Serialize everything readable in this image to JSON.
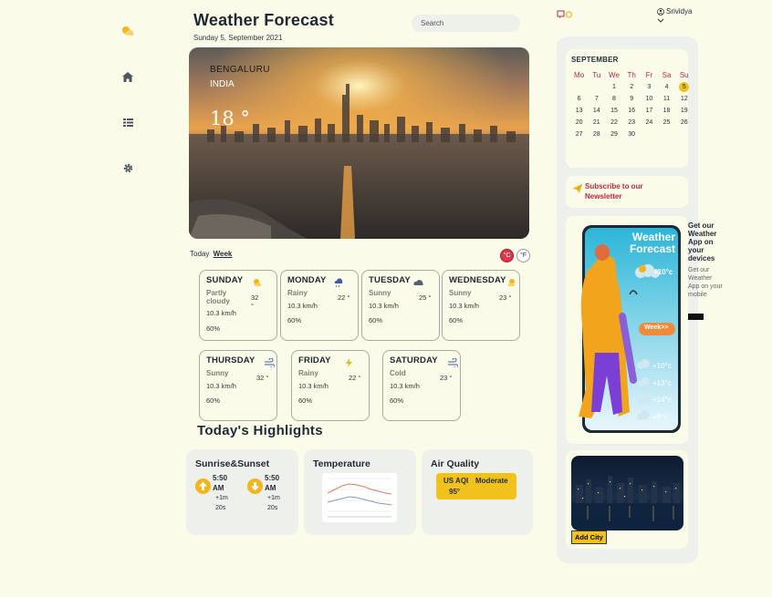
{
  "sidebar": {
    "icons": [
      "weather-icon",
      "home-icon",
      "list-icon",
      "gear-icon"
    ]
  },
  "header": {
    "title": "Weather Forecast",
    "date": "Sunday 5, September 2021",
    "search_placeholder": "Search"
  },
  "location": {
    "city": "BENGALURU",
    "country": "INDIA",
    "temp": "18 °"
  },
  "tabs": {
    "today": "Today",
    "week": "Week"
  },
  "units": {
    "celsius": "°C",
    "fahrenheit": "°F"
  },
  "days": [
    {
      "name": "SUNDAY",
      "condition": "Partly cloudy",
      "temp": "32 °",
      "wind": "10.3 km/h",
      "humidity": "60%",
      "icon": "partly-cloudy-icon"
    },
    {
      "name": "MONDAY",
      "condition": "Rainy",
      "temp": "22 °",
      "wind": "10.3 km/h",
      "humidity": "60%",
      "icon": "rain-icon"
    },
    {
      "name": "TUESDAY",
      "condition": "Sunny",
      "temp": "25 °",
      "wind": "10.3 km/h",
      "humidity": "60%",
      "icon": "cloud-icon"
    },
    {
      "name": "WEDNESDAY",
      "condition": "Sunny",
      "temp": "23 °",
      "wind": "10.3 km/h",
      "humidity": "60%",
      "icon": "sun-cloud-icon"
    },
    {
      "name": "THURSDAY",
      "condition": "Sunny",
      "temp": "32 °",
      "wind": "10.3 km/h",
      "humidity": "60%",
      "icon": "wind-icon"
    },
    {
      "name": "FRIDAY",
      "condition": "Rainy",
      "temp": "22 °",
      "wind": "10.3 km/h",
      "humidity": "60%",
      "icon": "lightning-icon"
    },
    {
      "name": "SATURDAY",
      "condition": "Cold",
      "temp": "23 °",
      "wind": "10.3 km/h",
      "humidity": "60%",
      "icon": "wind-icon"
    }
  ],
  "highlights": {
    "title": "Today's Highlights",
    "sun": {
      "label": "Sunrise&Sunset",
      "sunrise_time": "5:50",
      "sunrise_ampm": "AM",
      "sunrise_delta": "+1m",
      "sunrise_sec": "20s",
      "sunset_time": "5:50",
      "sunset_ampm": "AM",
      "sunset_delta": "+1m",
      "sunset_sec": "20s"
    },
    "temperature": {
      "label": "Temperature"
    },
    "air": {
      "label": "Air Quality",
      "index_label": "US AQI",
      "status": "Moderate",
      "value": "95°"
    }
  },
  "user": {
    "name": "Srividya"
  },
  "calendar": {
    "month": "SEPTEMBER",
    "weekdays": [
      "Mo",
      "Tu",
      "We",
      "Th",
      "Fr",
      "Sa",
      "Su"
    ],
    "days": [
      "",
      "",
      "1",
      "2",
      "3",
      "4",
      "5",
      "6",
      "7",
      "8",
      "9",
      "10",
      "11",
      "12",
      "13",
      "14",
      "15",
      "16",
      "17",
      "18",
      "19",
      "20",
      "21",
      "22",
      "23",
      "24",
      "25",
      "26",
      "27",
      "28",
      "29",
      "30"
    ],
    "selected": "5"
  },
  "subscribe": {
    "text": "Subscribe to our Newsletter"
  },
  "promo": {
    "title": "Get our Weather App on your devices",
    "subtitle": "Get our Weather App on your mobile",
    "phone_title": "Weather Forecast",
    "main_temp": "+10°c",
    "week_btn": "Week>>",
    "temps": [
      "+10°c",
      "+13°c",
      "+14°c",
      "+9°c"
    ]
  },
  "city": {
    "add_label": "Add City"
  },
  "colors": {
    "background": "#fbfbea",
    "accent": "#f2c21c",
    "danger": "#c4243d",
    "panel": "#eef0ec"
  }
}
